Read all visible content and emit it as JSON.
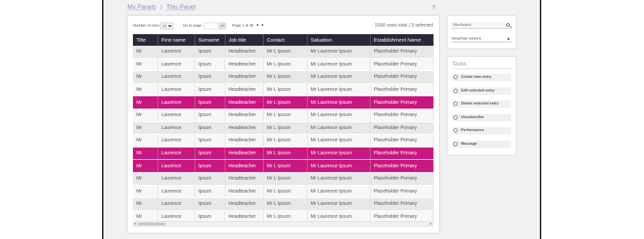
{
  "breadcrumb": {
    "parent": "My Panels",
    "separator": ")",
    "current": "This Panel"
  },
  "help_icon_label": "?",
  "toolbar": {
    "rows_label": "Number of rows",
    "rows_value": "10",
    "goto_label": "Go to page",
    "go_button": "go",
    "page_info": "Page 1 of 45",
    "rows_total": "1000 rows total | 3 selected"
  },
  "table": {
    "columns": [
      "Title",
      "First name",
      "Surname",
      "Job title",
      "Contact",
      "Saluation",
      "Establishment Name"
    ],
    "rows": [
      {
        "title": "Mr",
        "first": "Laurence",
        "surname": "Ipsum",
        "job": "Headteacher",
        "contact": "Mr L Ipsum",
        "salutation": "Mr Laurence Ipsum",
        "establishment": "Placeholder Primary",
        "selected": false
      },
      {
        "title": "Mr",
        "first": "Laurence",
        "surname": "Ipsum",
        "job": "Headteacher",
        "contact": "Mr L Ipsum",
        "salutation": "Mr Laurence Ipsum",
        "establishment": "Placeholder Primary",
        "selected": false
      },
      {
        "title": "Mr",
        "first": "Laurence",
        "surname": "Ipsum",
        "job": "Headteacher",
        "contact": "Mr L Ipsum",
        "salutation": "Mr Laurence Ipsum",
        "establishment": "Placeholder Primary",
        "selected": false
      },
      {
        "title": "Mr",
        "first": "Laurence",
        "surname": "Ipsum",
        "job": "Headteacher",
        "contact": "Mr L Ipsum",
        "salutation": "Mr Laurence Ipsum",
        "establishment": "Placeholder Primary",
        "selected": false
      },
      {
        "title": "Mr",
        "first": "Laurence",
        "surname": "Ipsum",
        "job": "Headteacher",
        "contact": "Mr L Ipsum",
        "salutation": "Mr Laurence Ipsum",
        "establishment": "Placeholder Primary",
        "selected": true
      },
      {
        "title": "Mr",
        "first": "Laurence",
        "surname": "Ipsum",
        "job": "Headteacher",
        "contact": "Mr L Ipsum",
        "salutation": "Mr Laurence Ipsum",
        "establishment": "Placeholder Primary",
        "selected": false
      },
      {
        "title": "Mr",
        "first": "Laurence",
        "surname": "Ipsum",
        "job": "Headteacher",
        "contact": "Mr L Ipsum",
        "salutation": "Mr Laurence Ipsum",
        "establishment": "Placeholder Primary",
        "selected": false
      },
      {
        "title": "Mr",
        "first": "Laurence",
        "surname": "Ipsum",
        "job": "Headteacher",
        "contact": "Mr L Ipsum",
        "salutation": "Mr Laurence Ipsum",
        "establishment": "Placeholder Primary",
        "selected": false
      },
      {
        "title": "Mr",
        "first": "Laurence",
        "surname": "Ipsum",
        "job": "Headteacher",
        "contact": "Mr L Ipsum",
        "salutation": "Mr Laurence Ipsum",
        "establishment": "Placeholder Primary",
        "selected": true
      },
      {
        "title": "Mr",
        "first": "Laurence",
        "surname": "Ipsum",
        "job": "Headteacher",
        "contact": "Mr L Ipsum",
        "salutation": "Mr Laurence Ipsum",
        "establishment": "Placeholder Primary",
        "selected": true
      },
      {
        "title": "Mr",
        "first": "Laurence",
        "surname": "Ipsum",
        "job": "Headteacher",
        "contact": "Mr L Ipsum",
        "salutation": "Mr Laurence Ipsum",
        "establishment": "Placeholder Primary",
        "selected": false
      },
      {
        "title": "Mr",
        "first": "Laurence",
        "surname": "Ipsum",
        "job": "Headteacher",
        "contact": "Mr L Ipsum",
        "salutation": "Mr Laurence Ipsum",
        "establishment": "Placeholder Primary",
        "selected": false
      },
      {
        "title": "Mr",
        "first": "Laurence",
        "surname": "Ipsum",
        "job": "Headteacher",
        "contact": "Mr L Ipsum",
        "salutation": "Mr Laurence Ipsum",
        "establishment": "Placeholder Primary",
        "selected": false
      },
      {
        "title": "Mr",
        "first": "Laurence",
        "surname": "Ipsum",
        "job": "Headteacher",
        "contact": "Mr L Ipsum",
        "salutation": "Mr Laurence Ipsum",
        "establishment": "Placeholder Primary",
        "selected": false
      }
    ]
  },
  "filter": {
    "placeholder": "FilterSearch",
    "columns_label": "Show/hide columns"
  },
  "tasks": {
    "title": "Tasks",
    "items": [
      "Create new entry",
      "Edit selected entry",
      "Delete selected entry",
      "Unsubscribe",
      "Performance",
      "Message"
    ]
  },
  "colors": {
    "header_bg": "#2c2737",
    "selected_row": "#c8187f",
    "link": "#9a87b5"
  }
}
